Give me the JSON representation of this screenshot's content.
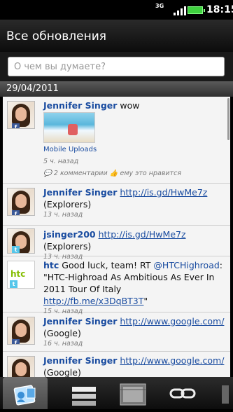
{
  "status_bar": {
    "network": "3G",
    "time": "18:15"
  },
  "header": {
    "title": "Все обновления"
  },
  "composer": {
    "placeholder": "О чем вы думаете?"
  },
  "date_header": "29/04/2011",
  "feed": [
    {
      "name": "Jennifer Singer",
      "text": " wow",
      "attachment_label": "Mobile Uploads",
      "time": "5 ч. назад",
      "comments": "2 комментарии",
      "likes": "ему это нравится",
      "source": "facebook"
    },
    {
      "name": "Jennifer Singer",
      "link": "http://is.gd/HwMe7z",
      "text_after": "(Explorers)",
      "time": "13 ч. назад",
      "source": "facebook"
    },
    {
      "name": "jsinger200",
      "link": "http://is.gd/HwMe7z",
      "text_after": "(Explorers)",
      "time": "13 ч. назад",
      "source": "twitter"
    },
    {
      "name": "htc",
      "text": " Good luck, team! RT ",
      "mention": "@HTCHighroad",
      "text2": ": \"HTC-Highroad As Ambitious As Ever In 2011 Tour Of Italy ",
      "link": "http://fb.me/x3DqBT3T",
      "text3": "\"",
      "time": "15 ч. назад",
      "source": "twitter",
      "logo_text": "htc"
    },
    {
      "name": "Jennifer Singer",
      "link": "http://www.google.com/",
      "text_after": "(Google)",
      "time": "16 ч. назад",
      "source": "facebook"
    },
    {
      "name": "Jennifer Singer",
      "link": "http://www.google.com/",
      "text_after": "(Google)",
      "source": "facebook"
    }
  ],
  "tabs": [
    {
      "icon": "updates-icon"
    },
    {
      "icon": "status-list-icon"
    },
    {
      "icon": "photos-icon"
    },
    {
      "icon": "links-icon"
    },
    {
      "icon": "more-icon"
    }
  ],
  "colors": {
    "link": "#1a4ca0",
    "feed_background": "#f4f4f4",
    "facebook_badge": "#3b5998",
    "twitter_badge": "#55c6ea",
    "htc_green": "#84bd00"
  }
}
